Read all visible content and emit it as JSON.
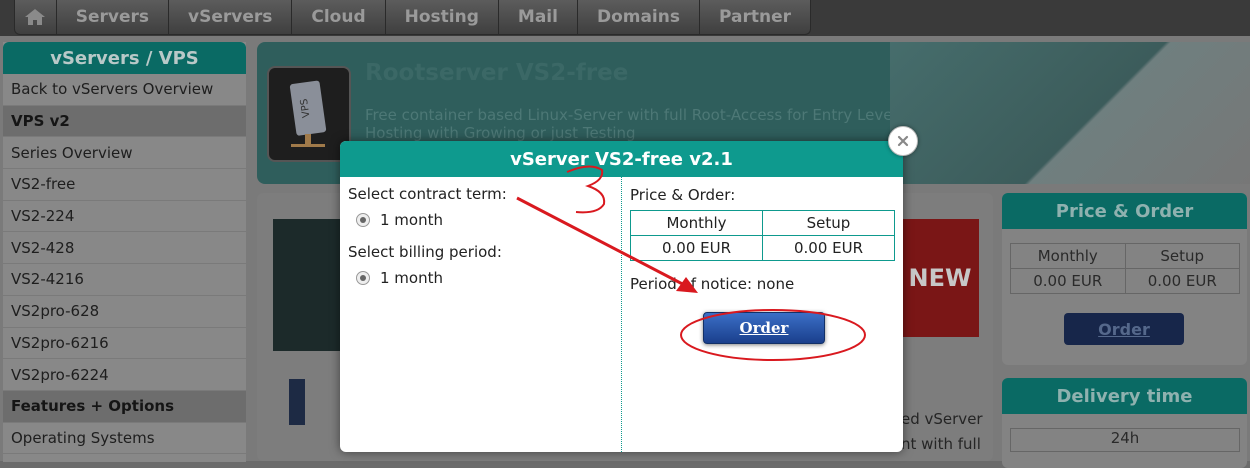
{
  "nav": {
    "items": [
      "Servers",
      "vServers",
      "Cloud",
      "Hosting",
      "Mail",
      "Domains",
      "Partner"
    ],
    "home_icon": "home-icon"
  },
  "sidebar": {
    "title": "vServers / VPS",
    "items": [
      {
        "label": "Back to vServers Overview",
        "category": false
      },
      {
        "label": "VPS v2",
        "category": true
      },
      {
        "label": "Series Overview",
        "category": false
      },
      {
        "label": "VS2-free",
        "category": false
      },
      {
        "label": "VS2-224",
        "category": false
      },
      {
        "label": "VS2-428",
        "category": false
      },
      {
        "label": "VS2-4216",
        "category": false
      },
      {
        "label": "VS2pro-628",
        "category": false
      },
      {
        "label": "VS2pro-6216",
        "category": false
      },
      {
        "label": "VS2pro-6224",
        "category": false
      },
      {
        "label": "Features + Options",
        "category": true
      },
      {
        "label": "Operating Systems",
        "category": false
      }
    ]
  },
  "hero": {
    "title": "Rootserver VS2-free",
    "subtitle": "Free container based Linux-Server with full Root-Access for Entry Level Hosting with Growing or just Testing"
  },
  "content": {
    "badge": "NEW",
    "text_line1": "ed vServer",
    "text_line2": "nt with full"
  },
  "price_panel": {
    "title": "Price & Order",
    "col_monthly": "Monthly",
    "col_setup": "Setup",
    "monthly": "0.00 EUR",
    "setup": "0.00 EUR",
    "order_label": "Order"
  },
  "delivery_panel": {
    "title": "Delivery time",
    "value": "24h"
  },
  "modal": {
    "title": "vServer VS2-free v2.1",
    "contract_label": "Select contract term:",
    "contract_value": "1 month",
    "billing_label": "Select billing period:",
    "billing_value": "1 month",
    "price_label": "Price & Order:",
    "col_monthly": "Monthly",
    "col_setup": "Setup",
    "monthly": "0.00 EUR",
    "setup": "0.00 EUR",
    "notice": "Period of notice: none",
    "order_label": "Order",
    "close_icon": "close-icon"
  },
  "annotation": {
    "color": "#d9191f"
  }
}
